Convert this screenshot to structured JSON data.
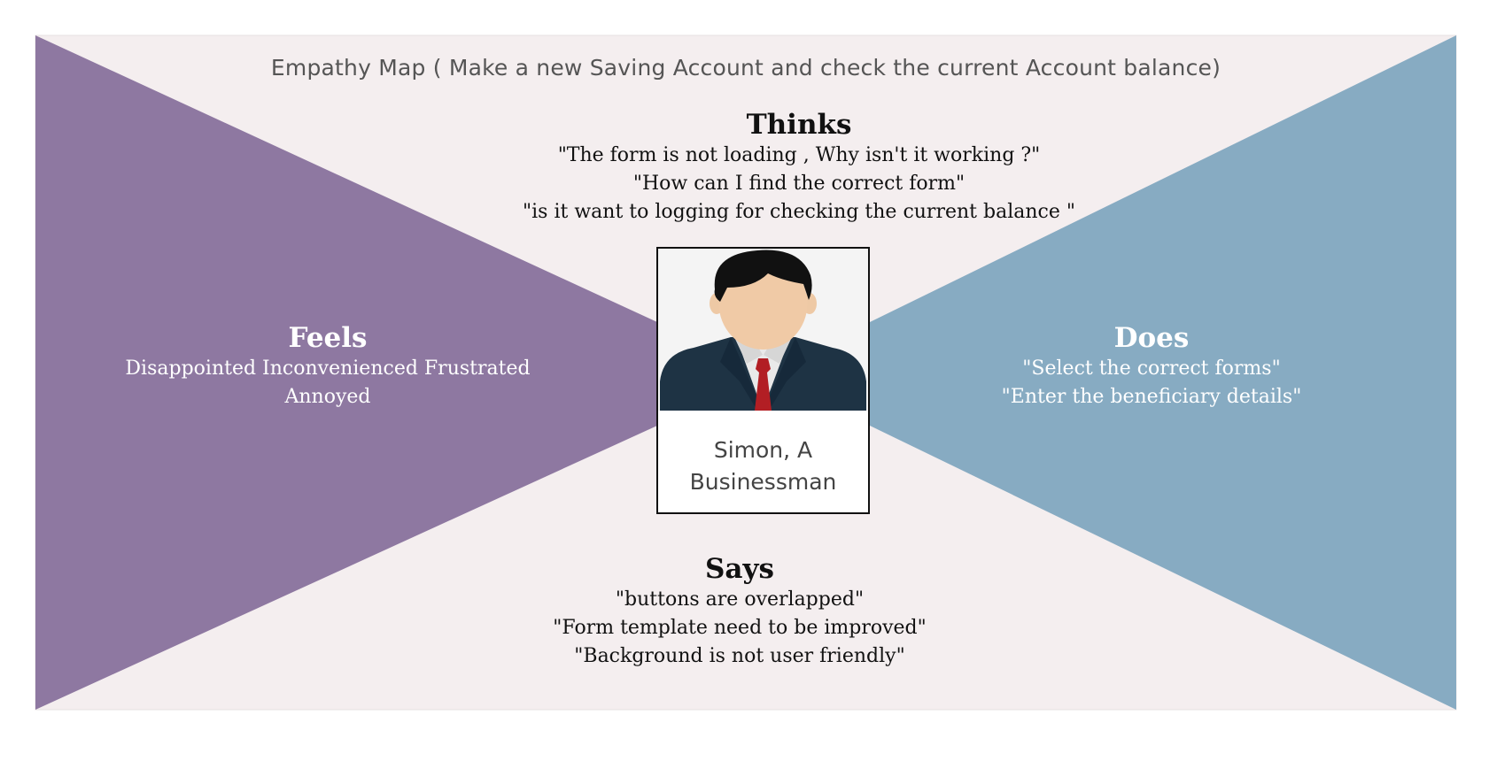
{
  "title": "Empathy Map ( Make a new Saving Account and check the current Account balance)",
  "colors": {
    "background_quadrant": "#f4eeef",
    "feels": "#8e78a1",
    "does": "#87abc2",
    "heading_dark": "#111111",
    "heading_light": "#ffffff"
  },
  "thinks": {
    "heading": "Thinks",
    "lines": [
      "\"The form is not loading , Why isn't it working ?\"",
      "\"How can I find the correct form\"",
      "\"is it want to logging for checking the current balance \""
    ]
  },
  "feels": {
    "heading": "Feels",
    "lines": [
      "Disappointed Inconvenienced  Frustrated",
      "Annoyed"
    ]
  },
  "does": {
    "heading": "Does",
    "lines": [
      "\"Select the correct forms\"",
      "\"Enter the beneficiary details\""
    ]
  },
  "says": {
    "heading": "Says",
    "lines": [
      "\"buttons are overlapped\"",
      "\"Form template need to be improved\"",
      "\"Background is not user friendly\""
    ]
  },
  "persona": {
    "name_line1": "Simon, A",
    "name_line2": "Businessman",
    "icon": "businessman-avatar-icon"
  }
}
